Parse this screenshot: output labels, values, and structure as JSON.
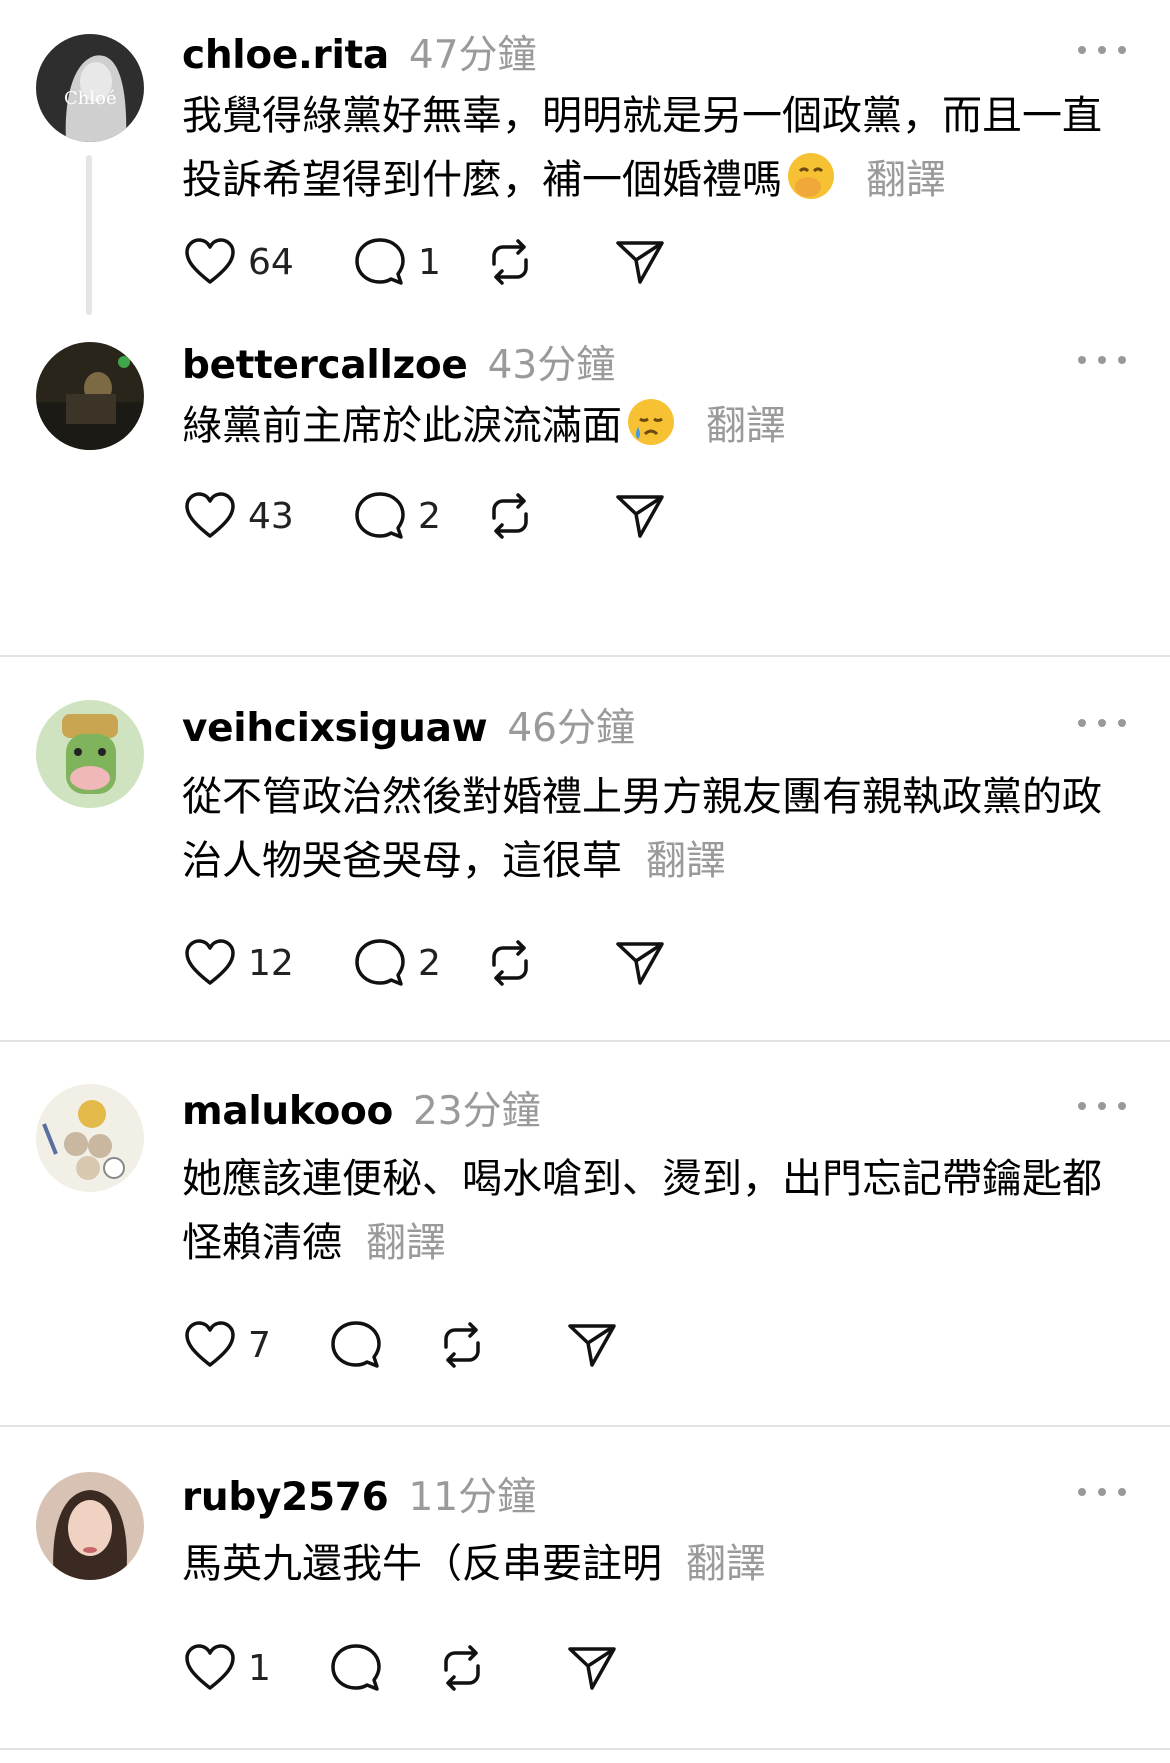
{
  "posts": [
    {
      "username": "chloe.rita",
      "time": "47分鐘",
      "text": "我覺得綠黨好無辜，明明就是另一個政黨，而且一直投訴希望得到什麼，補一個婚禮嗎",
      "emoji": "hand-over-mouth-emoji",
      "translate": "翻譯",
      "likes": "64",
      "replies": "1",
      "avatar_colors": [
        "#3a3a3a",
        "#c9c9c9"
      ]
    },
    {
      "username": "bettercallzoe",
      "time": "43分鐘",
      "text": "綠黨前主席於此淚流滿面",
      "emoji": "crying-face-emoji",
      "translate": "翻譯",
      "likes": "43",
      "replies": "2",
      "avatar_colors": [
        "#2f2a1e",
        "#7c6a45"
      ]
    },
    {
      "username": "veihcixsiguaw",
      "time": "46分鐘",
      "text": "從不管政治然後對婚禮上男方親友團有親執政黨的政治人物哭爸哭母，這很草",
      "emoji": "",
      "translate": "翻譯",
      "likes": "12",
      "replies": "2",
      "avatar_colors": [
        "#8fbf72",
        "#c9a552"
      ]
    },
    {
      "username": "malukooo",
      "time": "23分鐘",
      "text": "她應該連便秘、喝水嗆到、燙到，出門忘記帶鑰匙都怪賴清德",
      "emoji": "",
      "translate": "翻譯",
      "likes": "7",
      "replies": "",
      "avatar_colors": [
        "#e9e4d8",
        "#b79a6a"
      ]
    },
    {
      "username": "ruby2576",
      "time": "11分鐘",
      "text": "馬英九還我牛（反串要註明",
      "emoji": "",
      "translate": "翻譯",
      "likes": "1",
      "replies": "",
      "avatar_colors": [
        "#c79a83",
        "#3b2a22"
      ]
    }
  ]
}
